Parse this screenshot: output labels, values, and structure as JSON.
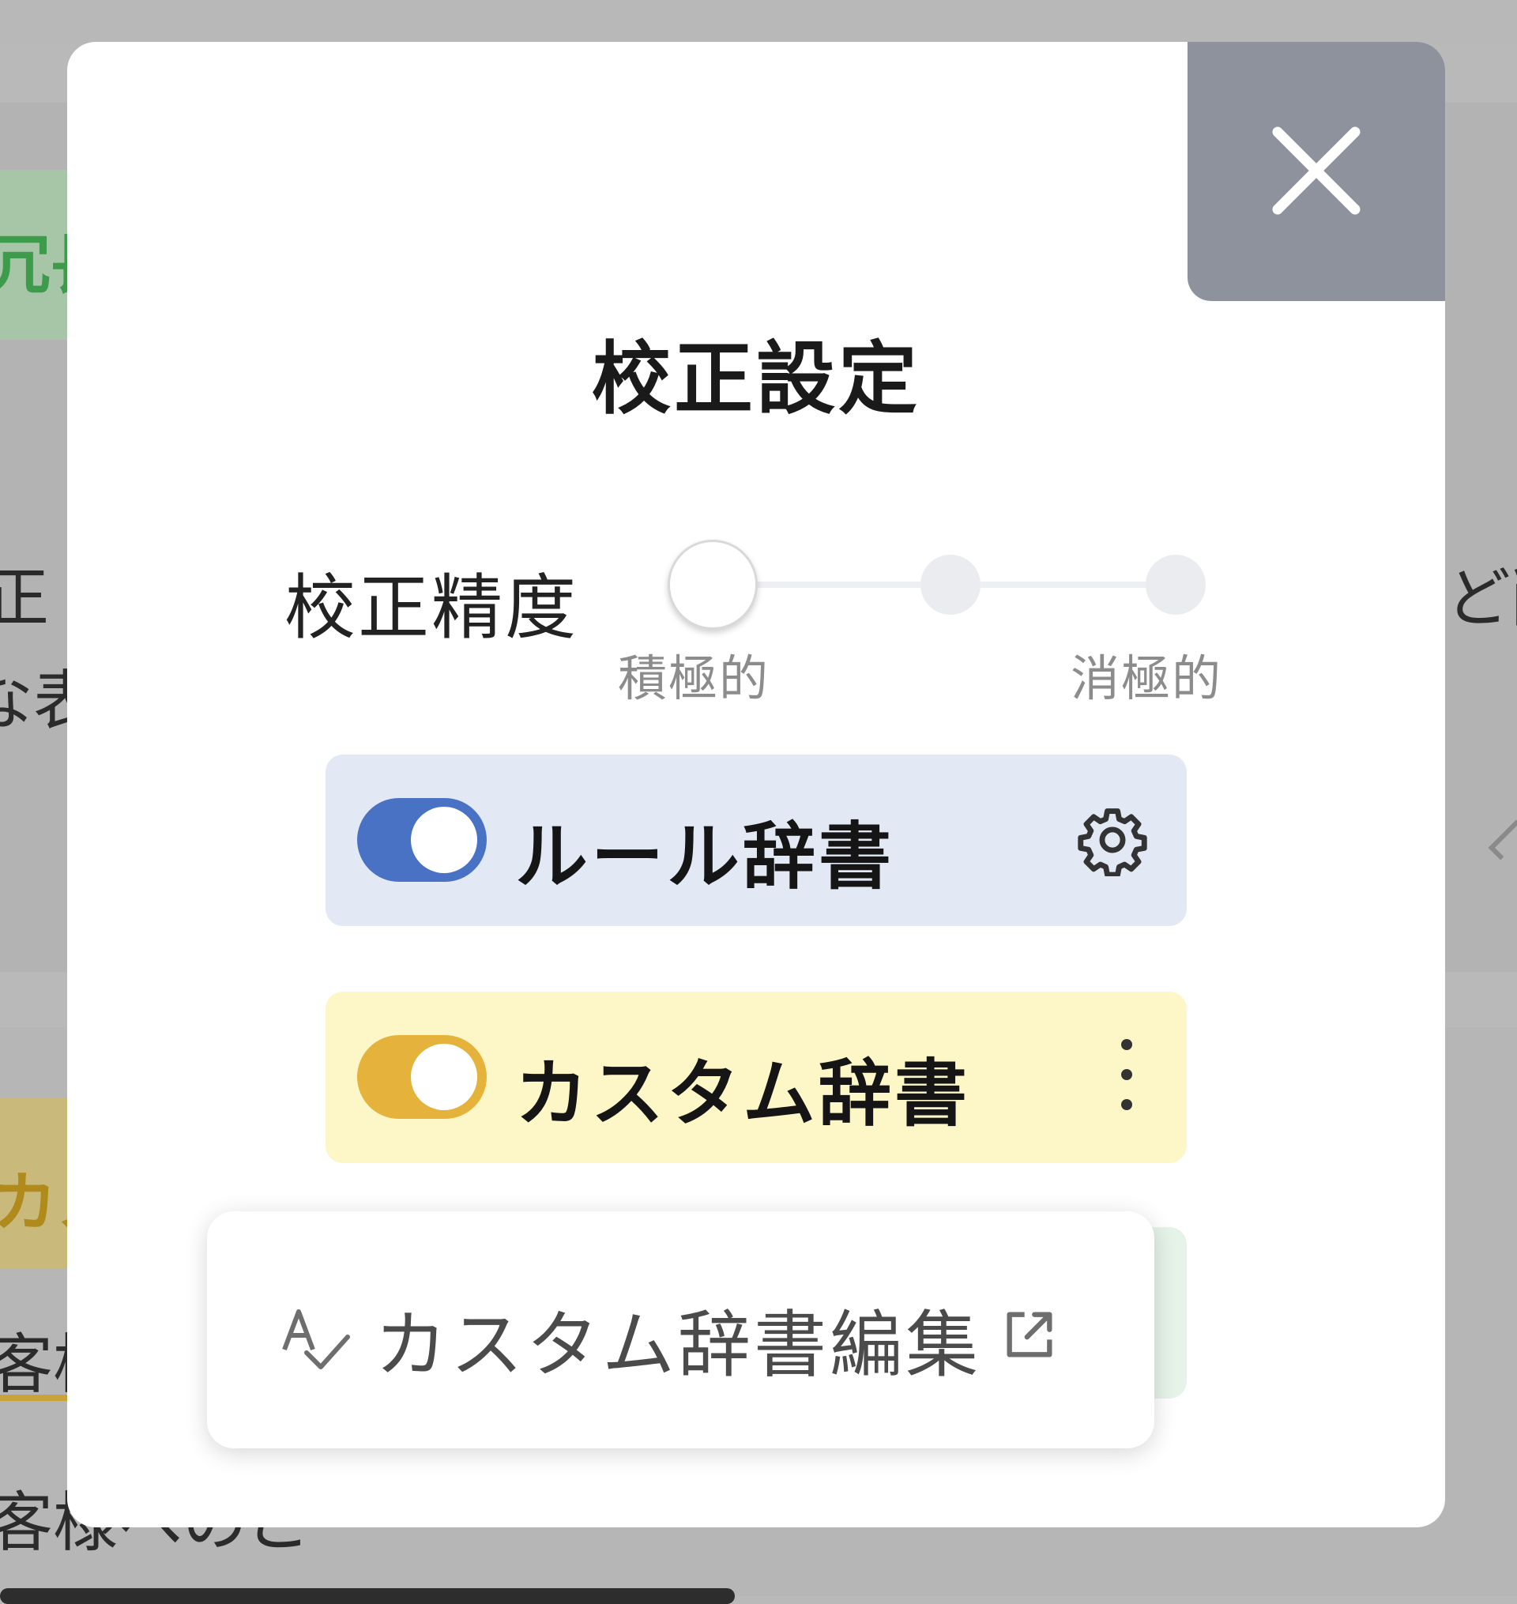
{
  "background": {
    "fragments": [
      "冗長",
      "正",
      "な表",
      "ど削",
      "カス",
      "客様",
      "客様へのご"
    ]
  },
  "modal": {
    "title": "校正設定",
    "close_icon": "close-icon",
    "precision": {
      "label": "校正精度",
      "min_label": "積極的",
      "max_label": "消極的",
      "steps": 3,
      "selected_step": 1
    },
    "dictionaries": [
      {
        "label": "ルール辞書",
        "enabled": true,
        "color": "#4a72c4",
        "action_icon": "gear-icon"
      },
      {
        "label": "カスタム辞書",
        "enabled": true,
        "color": "#e5b33c",
        "action_icon": "more-vertical-icon"
      }
    ],
    "popup": {
      "item_label": "カスタム辞書編集",
      "item_icon": "spellcheck-icon",
      "trailing_icon": "external-link-icon"
    }
  }
}
